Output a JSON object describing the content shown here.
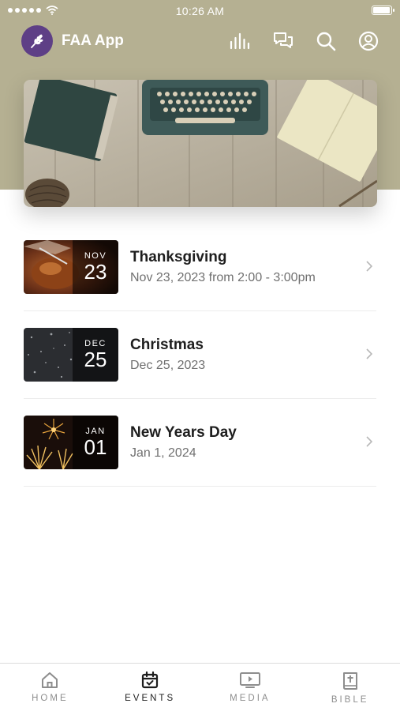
{
  "status_bar": {
    "time": "10:26 AM",
    "battery_level": 1.0
  },
  "header": {
    "app_title": "FAA App",
    "logo_icon": "wheat-icon",
    "icons": [
      "bars-chart-icon",
      "chat-icon",
      "search-icon",
      "profile-icon"
    ]
  },
  "banner": {
    "image": "typewriter-desk-photo"
  },
  "events": [
    {
      "title": "Thanksgiving",
      "subtitle": "Nov 23, 2023 from 2:00 - 3:00pm",
      "month": "NOV",
      "day": "23",
      "thumbnail": "thanksgiving-photo"
    },
    {
      "title": "Christmas",
      "subtitle": "Dec 25, 2023",
      "month": "DEC",
      "day": "25",
      "thumbnail": "snow-photo"
    },
    {
      "title": "New Years Day",
      "subtitle": "Jan 1, 2024",
      "month": "JAN",
      "day": "01",
      "thumbnail": "fireworks-photo"
    }
  ],
  "tabs": [
    {
      "label": "HOME",
      "icon": "home-icon",
      "active": false
    },
    {
      "label": "EVENTS",
      "icon": "calendar-icon",
      "active": true
    },
    {
      "label": "MEDIA",
      "icon": "tv-play-icon",
      "active": false
    },
    {
      "label": "BIBLE",
      "icon": "bible-icon",
      "active": false
    }
  ],
  "colors": {
    "header_band": "#b5b092",
    "logo_bg": "#5e3f86",
    "active_tab": "#1d1d1d",
    "inactive_tab": "#8d8d8d"
  }
}
